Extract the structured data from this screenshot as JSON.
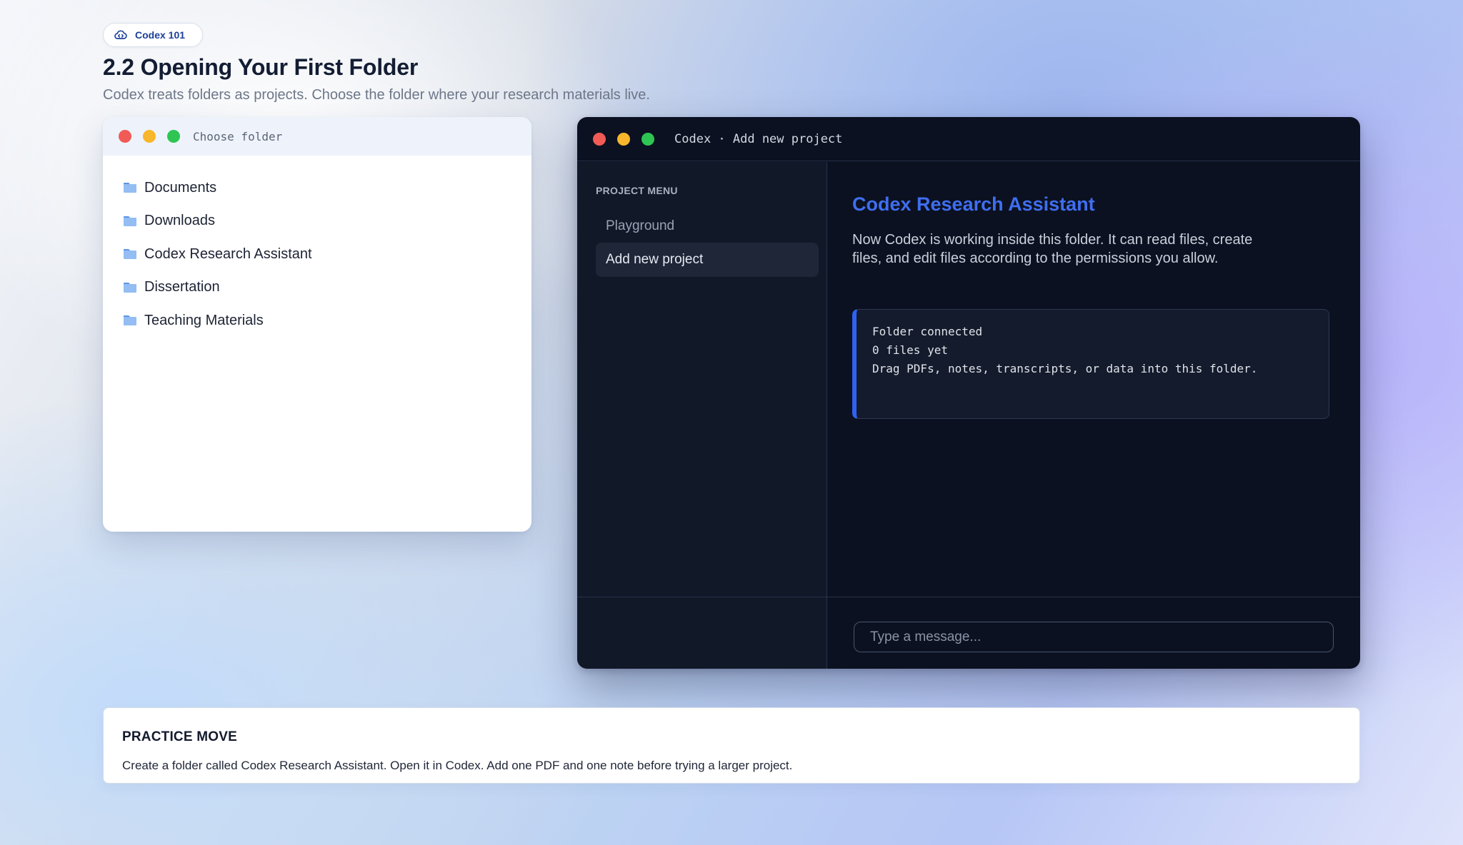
{
  "badge": {
    "label": "Codex 101",
    "icon": "cloud-code-icon"
  },
  "page": {
    "title": "2.2 Opening Your First Folder",
    "subtitle": "Codex treats folders as projects. Choose the folder where your research materials live."
  },
  "folder_window": {
    "title": "Choose folder",
    "folders": [
      {
        "label": "Documents",
        "icon": "folder-icon"
      },
      {
        "label": "Downloads",
        "icon": "folder-icon"
      },
      {
        "label": "Codex Research Assistant",
        "icon": "folder-icon"
      },
      {
        "label": "Dissertation",
        "icon": "folder-icon"
      },
      {
        "label": "Teaching Materials",
        "icon": "folder-icon"
      }
    ]
  },
  "codex_window": {
    "title": "Codex · Add new project",
    "sidebar": {
      "heading": "PROJECT MENU",
      "items": [
        {
          "label": "Playground",
          "selected": false
        },
        {
          "label": "Add new project",
          "selected": true
        }
      ]
    },
    "main": {
      "title": "Codex Research Assistant",
      "description": "Now Codex is working inside this folder. It can read files, create files, and edit files according to the permissions you allow.",
      "status_lines": [
        "Folder connected",
        "0 files yet",
        "Drag PDFs, notes, transcripts, or data into this folder."
      ]
    },
    "composer": {
      "placeholder": "Type a message...",
      "value": ""
    }
  },
  "practice": {
    "heading": "PRACTICE MOVE",
    "text": "Create a folder called Codex Research Assistant. Open it in Codex. Add one PDF and one note before trying a larger project."
  },
  "colors": {
    "accent": "#3f6ef0",
    "window_dark": "#0b1120",
    "sidebar_dark": "#111828",
    "traffic_red": "#f15b55",
    "traffic_yellow": "#f7b62b",
    "traffic_green": "#2ec553",
    "folder_blue": "#7aa9ee"
  }
}
